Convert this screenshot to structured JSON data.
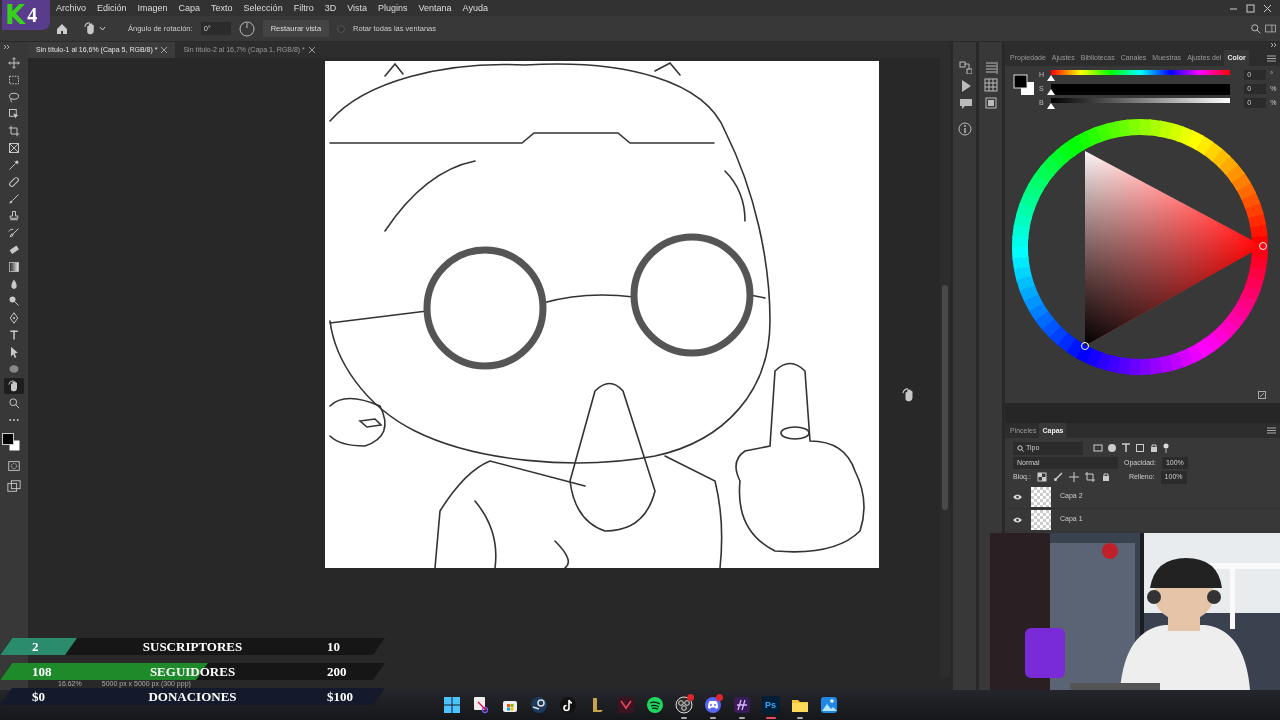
{
  "logo": {
    "letter": "K",
    "number": "4"
  },
  "menu": [
    "Archivo",
    "Edición",
    "Imagen",
    "Capa",
    "Texto",
    "Selección",
    "Filtro",
    "3D",
    "Vista",
    "Plugins",
    "Ventana",
    "Ayuda"
  ],
  "options": {
    "rotation_label": "Ángulo de rotación:",
    "rotation_value": "0°",
    "reset_button": "Restaurar vista",
    "rotate_all": {
      "label": "Rotar todas las ventanas",
      "checked": false
    }
  },
  "documents": [
    {
      "title": "Sin título-1 al 16,6% (Capa 5, RGB/8) *",
      "selected": true
    },
    {
      "title": "Sin título-2 al 16,7% (Capa 1, RGB/8) *",
      "selected": false
    }
  ],
  "tools": [
    {
      "kind": "move",
      "selected": false
    },
    {
      "kind": "marquee",
      "selected": false
    },
    {
      "kind": "lasso",
      "selected": false
    },
    {
      "kind": "object-select",
      "selected": false
    },
    {
      "kind": "crop",
      "selected": false
    },
    {
      "kind": "frame",
      "selected": false
    },
    {
      "kind": "eyedropper",
      "selected": false
    },
    {
      "kind": "healing",
      "selected": false
    },
    {
      "kind": "brush",
      "selected": false
    },
    {
      "kind": "stamp",
      "selected": false
    },
    {
      "kind": "history-brush",
      "selected": false
    },
    {
      "kind": "eraser",
      "selected": false
    },
    {
      "kind": "gradient",
      "selected": false
    },
    {
      "kind": "blur",
      "selected": false
    },
    {
      "kind": "dodge",
      "selected": false
    },
    {
      "kind": "pen",
      "selected": false
    },
    {
      "kind": "type",
      "selected": false
    },
    {
      "kind": "path-select",
      "selected": false
    },
    {
      "kind": "shape",
      "selected": false
    },
    {
      "kind": "rotate-view",
      "selected": true
    },
    {
      "kind": "zoom",
      "selected": false
    },
    {
      "kind": "more",
      "selected": false
    }
  ],
  "color_panel": {
    "tabs": [
      {
        "label": "Propiedade",
        "selected": false
      },
      {
        "label": "Ajustes",
        "selected": false
      },
      {
        "label": "Bibliotecas",
        "selected": false
      },
      {
        "label": "Canales",
        "selected": false
      },
      {
        "label": "Muestras",
        "selected": false
      },
      {
        "label": "Ajustes del",
        "selected": false
      },
      {
        "label": "Color",
        "selected": true
      }
    ],
    "sliders": [
      {
        "kind": "hue",
        "label": "H",
        "value": "0",
        "unit": "°",
        "level": 0
      },
      {
        "kind": "saturation",
        "label": "S",
        "value": "0",
        "unit": "%",
        "level": 0
      },
      {
        "kind": "brightness",
        "label": "B",
        "value": "0",
        "unit": "%",
        "level": 0
      }
    ]
  },
  "layers_panel": {
    "tabs": [
      {
        "label": "Pinceles",
        "selected": false
      },
      {
        "label": "Capas",
        "selected": true
      }
    ],
    "filter": "Tipo",
    "blend_mode": "Normal",
    "opacity_label": "Opacidad:",
    "opacity": "100%",
    "lock_label": "Bloq.:",
    "fill_label": "Relleno:",
    "fill": "100%",
    "layers": [
      {
        "name": "Capa 2",
        "visible": true
      },
      {
        "name": "Capa 1",
        "visible": true
      }
    ]
  },
  "status_bar": {
    "zoom": "16.62%",
    "size": "5000 px x 5000 px (300 ppp)"
  },
  "stream_goals": [
    {
      "current": "2",
      "label": "SUSCRIPTORES",
      "goal": "10",
      "level": 0.2,
      "color": "#2a8c6c"
    },
    {
      "current": "108",
      "label": "SEGUIDORES",
      "goal": "200",
      "level": 0.54,
      "color": "#1f8a2a"
    },
    {
      "current": "$0",
      "label": "DONACIONES",
      "goal": "$100",
      "level": 0,
      "color": "#141a2c"
    }
  ],
  "taskbar": [
    {
      "kind": "start",
      "running": false,
      "selected": false,
      "notification": false
    },
    {
      "kind": "snipping",
      "running": false,
      "selected": false,
      "notification": false
    },
    {
      "kind": "store",
      "running": false,
      "selected": false,
      "notification": false
    },
    {
      "kind": "steam",
      "running": false,
      "selected": false,
      "notification": false
    },
    {
      "kind": "tiktok",
      "running": false,
      "selected": false,
      "notification": false
    },
    {
      "kind": "league",
      "running": false,
      "selected": false,
      "notification": false
    },
    {
      "kind": "valorant",
      "running": false,
      "selected": false,
      "notification": false
    },
    {
      "kind": "spotify",
      "running": false,
      "selected": false,
      "notification": false
    },
    {
      "kind": "obs",
      "running": true,
      "selected": false,
      "notification": true
    },
    {
      "kind": "discord",
      "running": true,
      "selected": false,
      "notification": true
    },
    {
      "kind": "app",
      "running": true,
      "selected": false,
      "notification": false
    },
    {
      "kind": "photoshop",
      "label": "Ps",
      "running": true,
      "selected": true,
      "notification": false
    },
    {
      "kind": "explorer",
      "running": true,
      "selected": false,
      "notification": false
    },
    {
      "kind": "photos",
      "running": false,
      "selected": false,
      "notification": false
    }
  ]
}
